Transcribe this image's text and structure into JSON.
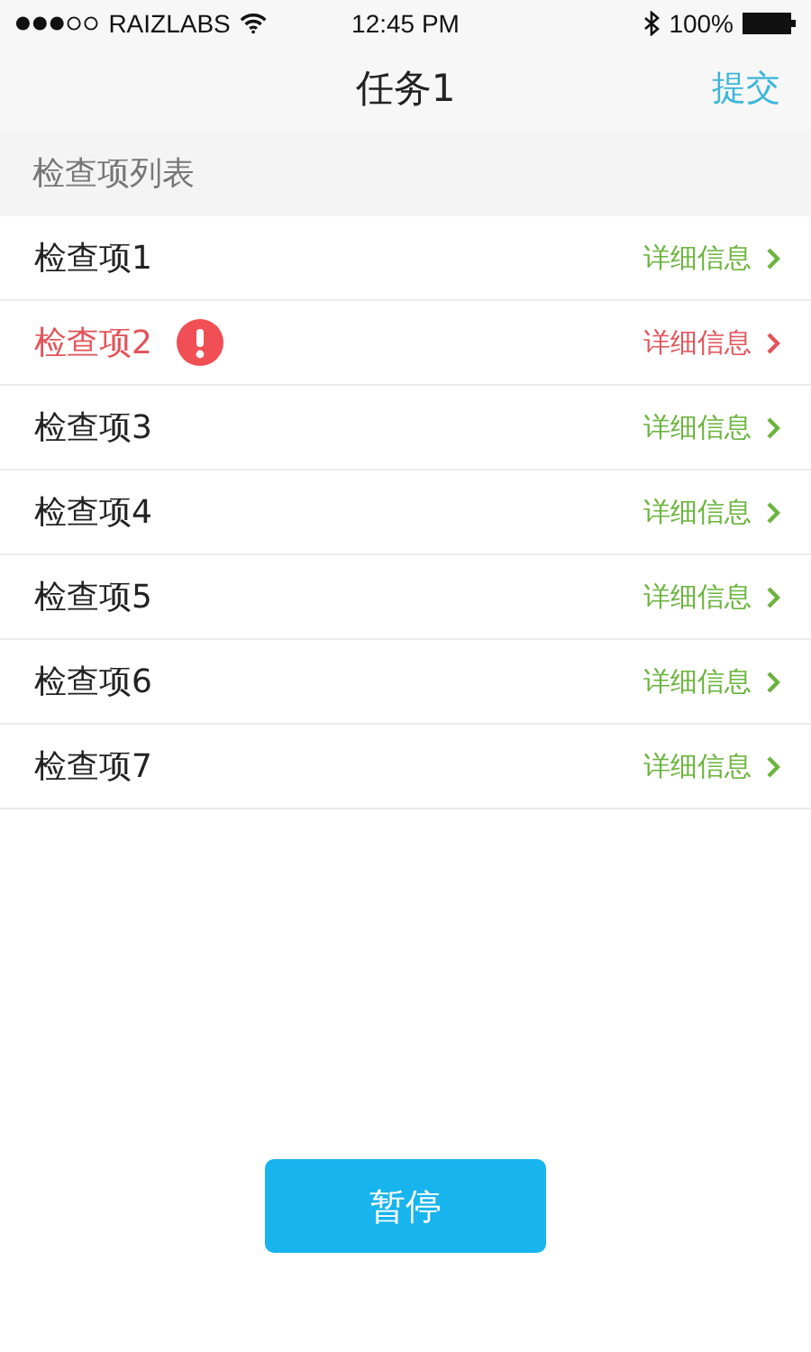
{
  "status_bar": {
    "carrier": "RAIZLABS",
    "time": "12:45 PM",
    "battery": "100%"
  },
  "nav": {
    "title": "任务1",
    "action": "提交"
  },
  "section": {
    "title": "检查项列表"
  },
  "items": [
    {
      "label": "检查项1",
      "link": "详细信息",
      "error": false
    },
    {
      "label": "检查项2",
      "link": "详细信息",
      "error": true
    },
    {
      "label": "检查项3",
      "link": "详细信息",
      "error": false
    },
    {
      "label": "检查项4",
      "link": "详细信息",
      "error": false
    },
    {
      "label": "检查项5",
      "link": "详细信息",
      "error": false
    },
    {
      "label": "检查项6",
      "link": "详细信息",
      "error": false
    },
    {
      "label": "检查项7",
      "link": "详细信息",
      "error": false
    }
  ],
  "pause_button": "暂停"
}
